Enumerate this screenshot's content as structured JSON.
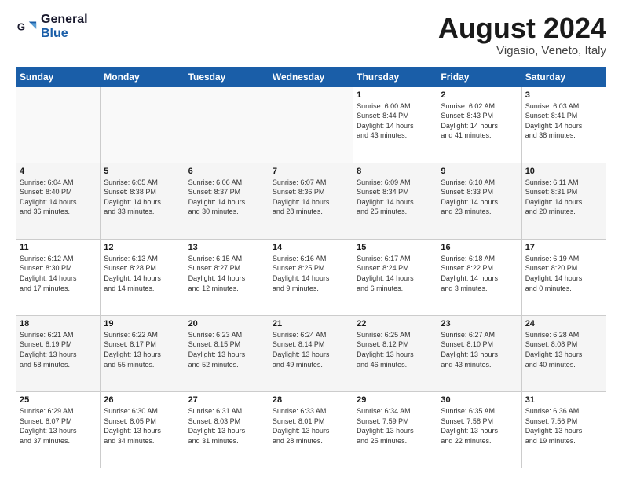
{
  "header": {
    "logo_line1": "General",
    "logo_line2": "Blue",
    "main_title": "August 2024",
    "subtitle": "Vigasio, Veneto, Italy"
  },
  "days_of_week": [
    "Sunday",
    "Monday",
    "Tuesday",
    "Wednesday",
    "Thursday",
    "Friday",
    "Saturday"
  ],
  "weeks": [
    [
      {
        "day": "",
        "info": ""
      },
      {
        "day": "",
        "info": ""
      },
      {
        "day": "",
        "info": ""
      },
      {
        "day": "",
        "info": ""
      },
      {
        "day": "1",
        "info": "Sunrise: 6:00 AM\nSunset: 8:44 PM\nDaylight: 14 hours\nand 43 minutes."
      },
      {
        "day": "2",
        "info": "Sunrise: 6:02 AM\nSunset: 8:43 PM\nDaylight: 14 hours\nand 41 minutes."
      },
      {
        "day": "3",
        "info": "Sunrise: 6:03 AM\nSunset: 8:41 PM\nDaylight: 14 hours\nand 38 minutes."
      }
    ],
    [
      {
        "day": "4",
        "info": "Sunrise: 6:04 AM\nSunset: 8:40 PM\nDaylight: 14 hours\nand 36 minutes."
      },
      {
        "day": "5",
        "info": "Sunrise: 6:05 AM\nSunset: 8:38 PM\nDaylight: 14 hours\nand 33 minutes."
      },
      {
        "day": "6",
        "info": "Sunrise: 6:06 AM\nSunset: 8:37 PM\nDaylight: 14 hours\nand 30 minutes."
      },
      {
        "day": "7",
        "info": "Sunrise: 6:07 AM\nSunset: 8:36 PM\nDaylight: 14 hours\nand 28 minutes."
      },
      {
        "day": "8",
        "info": "Sunrise: 6:09 AM\nSunset: 8:34 PM\nDaylight: 14 hours\nand 25 minutes."
      },
      {
        "day": "9",
        "info": "Sunrise: 6:10 AM\nSunset: 8:33 PM\nDaylight: 14 hours\nand 23 minutes."
      },
      {
        "day": "10",
        "info": "Sunrise: 6:11 AM\nSunset: 8:31 PM\nDaylight: 14 hours\nand 20 minutes."
      }
    ],
    [
      {
        "day": "11",
        "info": "Sunrise: 6:12 AM\nSunset: 8:30 PM\nDaylight: 14 hours\nand 17 minutes."
      },
      {
        "day": "12",
        "info": "Sunrise: 6:13 AM\nSunset: 8:28 PM\nDaylight: 14 hours\nand 14 minutes."
      },
      {
        "day": "13",
        "info": "Sunrise: 6:15 AM\nSunset: 8:27 PM\nDaylight: 14 hours\nand 12 minutes."
      },
      {
        "day": "14",
        "info": "Sunrise: 6:16 AM\nSunset: 8:25 PM\nDaylight: 14 hours\nand 9 minutes."
      },
      {
        "day": "15",
        "info": "Sunrise: 6:17 AM\nSunset: 8:24 PM\nDaylight: 14 hours\nand 6 minutes."
      },
      {
        "day": "16",
        "info": "Sunrise: 6:18 AM\nSunset: 8:22 PM\nDaylight: 14 hours\nand 3 minutes."
      },
      {
        "day": "17",
        "info": "Sunrise: 6:19 AM\nSunset: 8:20 PM\nDaylight: 14 hours\nand 0 minutes."
      }
    ],
    [
      {
        "day": "18",
        "info": "Sunrise: 6:21 AM\nSunset: 8:19 PM\nDaylight: 13 hours\nand 58 minutes."
      },
      {
        "day": "19",
        "info": "Sunrise: 6:22 AM\nSunset: 8:17 PM\nDaylight: 13 hours\nand 55 minutes."
      },
      {
        "day": "20",
        "info": "Sunrise: 6:23 AM\nSunset: 8:15 PM\nDaylight: 13 hours\nand 52 minutes."
      },
      {
        "day": "21",
        "info": "Sunrise: 6:24 AM\nSunset: 8:14 PM\nDaylight: 13 hours\nand 49 minutes."
      },
      {
        "day": "22",
        "info": "Sunrise: 6:25 AM\nSunset: 8:12 PM\nDaylight: 13 hours\nand 46 minutes."
      },
      {
        "day": "23",
        "info": "Sunrise: 6:27 AM\nSunset: 8:10 PM\nDaylight: 13 hours\nand 43 minutes."
      },
      {
        "day": "24",
        "info": "Sunrise: 6:28 AM\nSunset: 8:08 PM\nDaylight: 13 hours\nand 40 minutes."
      }
    ],
    [
      {
        "day": "25",
        "info": "Sunrise: 6:29 AM\nSunset: 8:07 PM\nDaylight: 13 hours\nand 37 minutes."
      },
      {
        "day": "26",
        "info": "Sunrise: 6:30 AM\nSunset: 8:05 PM\nDaylight: 13 hours\nand 34 minutes."
      },
      {
        "day": "27",
        "info": "Sunrise: 6:31 AM\nSunset: 8:03 PM\nDaylight: 13 hours\nand 31 minutes."
      },
      {
        "day": "28",
        "info": "Sunrise: 6:33 AM\nSunset: 8:01 PM\nDaylight: 13 hours\nand 28 minutes."
      },
      {
        "day": "29",
        "info": "Sunrise: 6:34 AM\nSunset: 7:59 PM\nDaylight: 13 hours\nand 25 minutes."
      },
      {
        "day": "30",
        "info": "Sunrise: 6:35 AM\nSunset: 7:58 PM\nDaylight: 13 hours\nand 22 minutes."
      },
      {
        "day": "31",
        "info": "Sunrise: 6:36 AM\nSunset: 7:56 PM\nDaylight: 13 hours\nand 19 minutes."
      }
    ]
  ]
}
